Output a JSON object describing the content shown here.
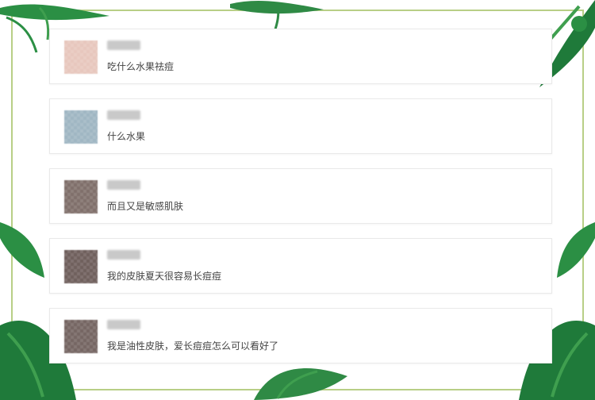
{
  "comments": [
    {
      "message": "吃什么水果祛痘"
    },
    {
      "message": "什么水果"
    },
    {
      "message": "而且又是敏感肌肤"
    },
    {
      "message": "我的皮肤夏天很容易长痘痘"
    },
    {
      "message": "我是油性皮肤，爱长痘痘怎么可以看好了"
    }
  ],
  "colors": {
    "frame_border": "#b8cf86",
    "card_border": "#e9e9e9",
    "text": "#444444",
    "leaf_dark": "#1f7a3a",
    "leaf_light": "#3f9f4f"
  }
}
